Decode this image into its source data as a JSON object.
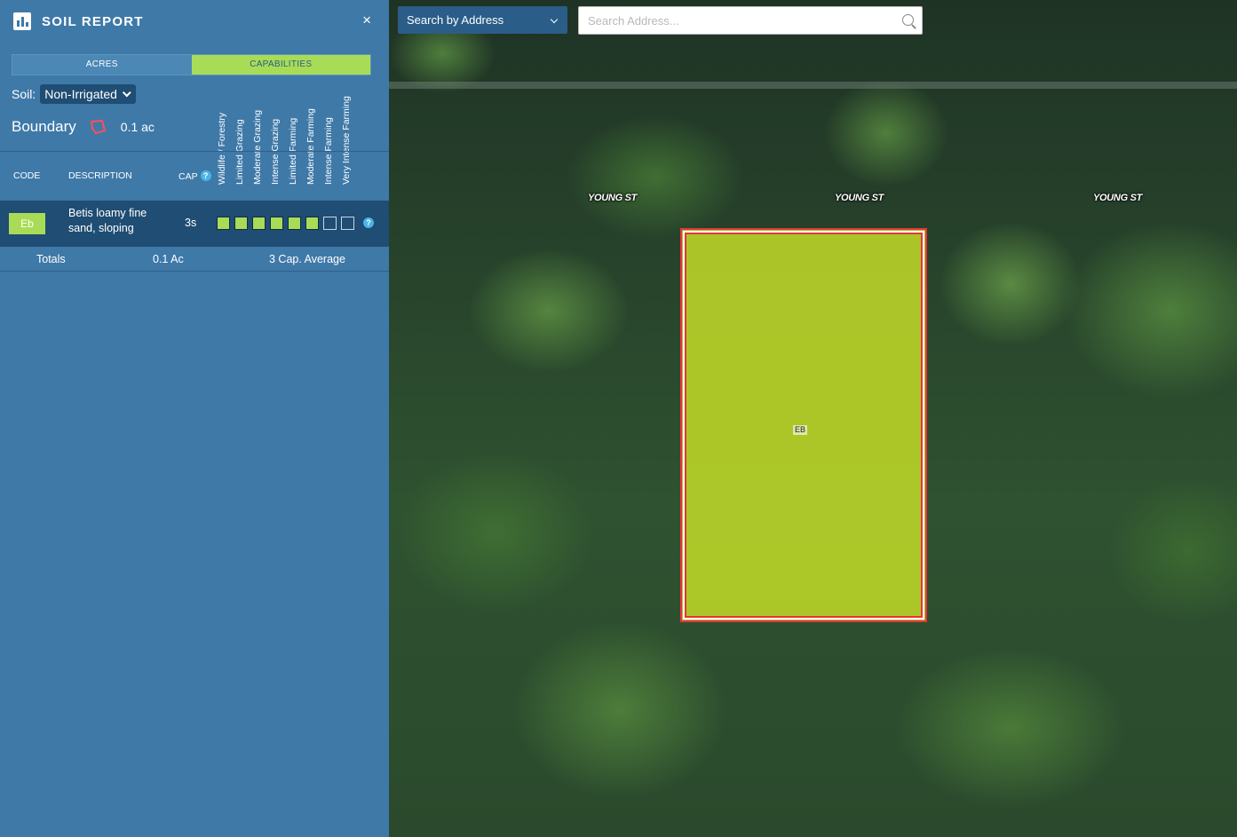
{
  "sidebar": {
    "title": "SOIL REPORT",
    "close_label": "×",
    "tabs": {
      "acres": "ACRES",
      "capabilities": "CAPABILITIES"
    },
    "soil": {
      "label": "Soil:",
      "selected": "Non-Irrigated"
    },
    "boundary": {
      "label": "Boundary",
      "value": "0.1 ac"
    },
    "capability_columns": [
      "Wildlife / Forestry",
      "Limited Grazing",
      "Moderate Grazing",
      "Intense Grazing",
      "Limited Farming",
      "Moderate Farming",
      "Intense Farming",
      "Very Intense Farming"
    ],
    "table_headers": {
      "code": "CODE",
      "description": "DESCRIPTION",
      "cap": "CAP"
    },
    "help_glyph": "?",
    "rows": [
      {
        "code": "Eb",
        "description": "Betis loamy fine sand, sloping",
        "cap": "3s",
        "capability_level": 6,
        "capability_total": 8
      }
    ],
    "totals": {
      "label": "Totals",
      "acres": "0.1 Ac",
      "average": "3 Cap. Average"
    }
  },
  "map": {
    "search_mode": "Search by Address",
    "search_placeholder": "Search Address...",
    "street_labels": [
      "YOUNG ST",
      "YOUNG ST",
      "YOUNG ST"
    ],
    "parcel_label": "EB"
  },
  "colors": {
    "sidebar_bg": "#3f79a8",
    "row_bg": "#1f4d73",
    "accent_green": "#a9dc56",
    "boundary_red": "#e8353a"
  }
}
